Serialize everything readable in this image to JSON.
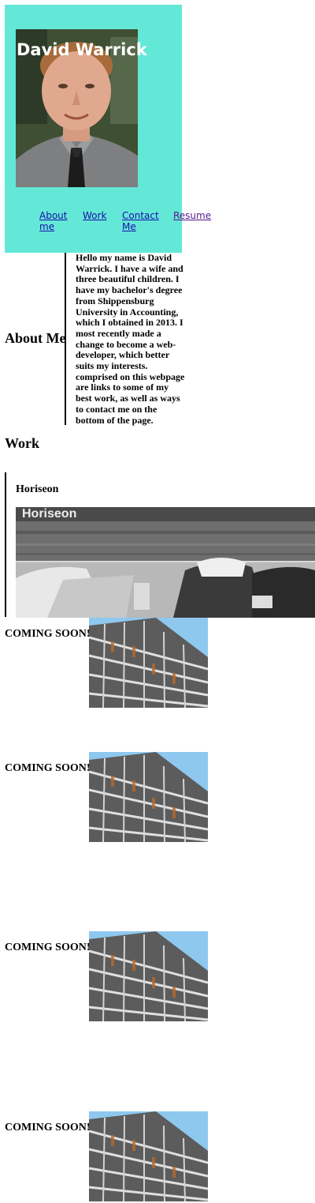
{
  "header": {
    "name": "David Warrick",
    "hero_color": "#63e8d8",
    "nav": [
      {
        "line1": "About",
        "line2": "me"
      },
      {
        "line1": "Work",
        "line2": ""
      },
      {
        "line1": "Contact",
        "line2": "Me"
      },
      {
        "line1": "Resume",
        "line2": ""
      }
    ]
  },
  "about": {
    "heading": "About Me",
    "text": "Hello my name is David Warrick. I have a wife and three beautiful children. I have my bachelor's degree from Shippensburg University in Accounting, which I obtained in 2013. I most recently made a change to become a web-developer, which better suits my interests. comprised on this webpage are links to some of my best work, as well as ways to contact me on the bottom of the page."
  },
  "work": {
    "heading": "Work",
    "projects": [
      {
        "title": "Horiseon",
        "image_text": "Horiseon"
      }
    ],
    "coming_soon": [
      {
        "label": "COMING SOON!"
      },
      {
        "label": "COMING SOON!"
      },
      {
        "label": "COMING SOON!"
      },
      {
        "label": "COMING SOON!"
      }
    ]
  }
}
